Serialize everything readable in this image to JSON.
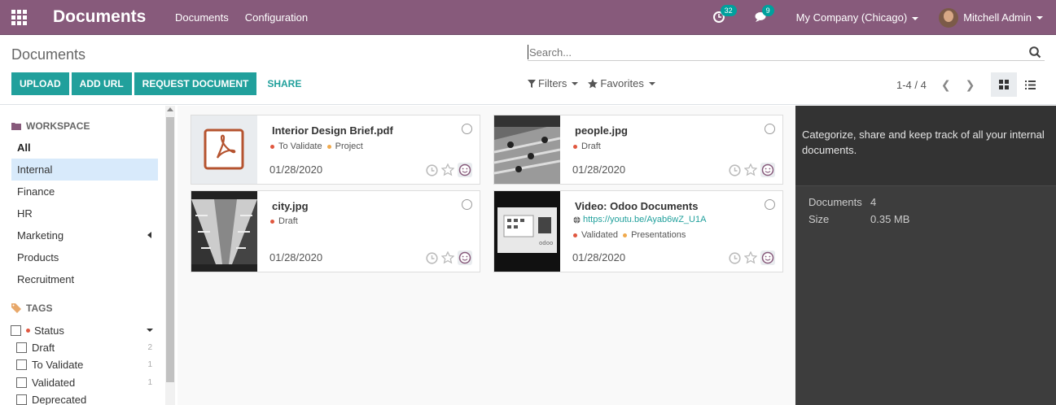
{
  "navbar": {
    "app_title": "Documents",
    "menu": [
      "Documents",
      "Configuration"
    ],
    "activity_count": "32",
    "message_count": "9",
    "company": "My Company (Chicago)",
    "user": "Mitchell Admin"
  },
  "control_panel": {
    "breadcrumb": "Documents",
    "search_placeholder": "Search...",
    "buttons": [
      "UPLOAD",
      "ADD URL",
      "REQUEST DOCUMENT",
      "SHARE"
    ],
    "filters_label": "Filters",
    "favorites_label": "Favorites",
    "pager": "1-4 / 4"
  },
  "sidebar": {
    "workspace_title": "WORKSPACE",
    "workspaces": [
      "All",
      "Internal",
      "Finance",
      "HR",
      "Marketing",
      "Products",
      "Recruitment"
    ],
    "tags_title": "TAGS",
    "status_label": "Status",
    "tags": [
      {
        "label": "Draft",
        "count": "2"
      },
      {
        "label": "To Validate",
        "count": "1"
      },
      {
        "label": "Validated",
        "count": "1"
      },
      {
        "label": "Deprecated",
        "count": ""
      }
    ]
  },
  "cards": [
    {
      "title": "Interior Design Brief.pdf",
      "tags": [
        "To Validate",
        "Project"
      ],
      "date": "01/28/2020"
    },
    {
      "title": "people.jpg",
      "tags": [
        "Draft"
      ],
      "date": "01/28/2020"
    },
    {
      "title": "city.jpg",
      "tags": [
        "Draft"
      ],
      "date": "01/28/2020"
    },
    {
      "title": "Video: Odoo Documents",
      "url": "https://youtu.be/Ayab6wZ_U1A",
      "tags": [
        "Validated",
        "Presentations"
      ],
      "date": "01/28/2020"
    }
  ],
  "right_panel": {
    "description": "Categorize, share and keep track of all your internal documents.",
    "documents_label": "Documents",
    "documents_value": "4",
    "size_label": "Size",
    "size_value": "0.35 MB"
  },
  "colors": {
    "brand": "#875a7b",
    "accent": "#21a09c",
    "tag_red": "#e0573f",
    "tag_orange": "#f0a94c"
  }
}
